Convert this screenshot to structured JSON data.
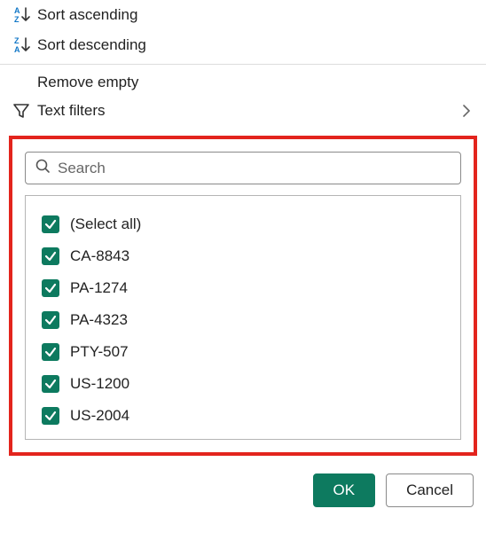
{
  "menu": {
    "sort_asc": {
      "label": "Sort ascending"
    },
    "sort_desc": {
      "label": "Sort descending"
    },
    "remove_empty": {
      "label": "Remove empty"
    },
    "text_filters": {
      "label": "Text filters"
    }
  },
  "search": {
    "placeholder": "Search"
  },
  "items": [
    {
      "label": "(Select all)",
      "checked": true
    },
    {
      "label": "CA-8843",
      "checked": true
    },
    {
      "label": "PA-1274",
      "checked": true
    },
    {
      "label": "PA-4323",
      "checked": true
    },
    {
      "label": "PTY-507",
      "checked": true
    },
    {
      "label": "US-1200",
      "checked": true
    },
    {
      "label": "US-2004",
      "checked": true
    }
  ],
  "buttons": {
    "ok": "OK",
    "cancel": "Cancel"
  },
  "colors": {
    "accent": "#0d7a5f",
    "highlight_border": "#e3241d"
  }
}
